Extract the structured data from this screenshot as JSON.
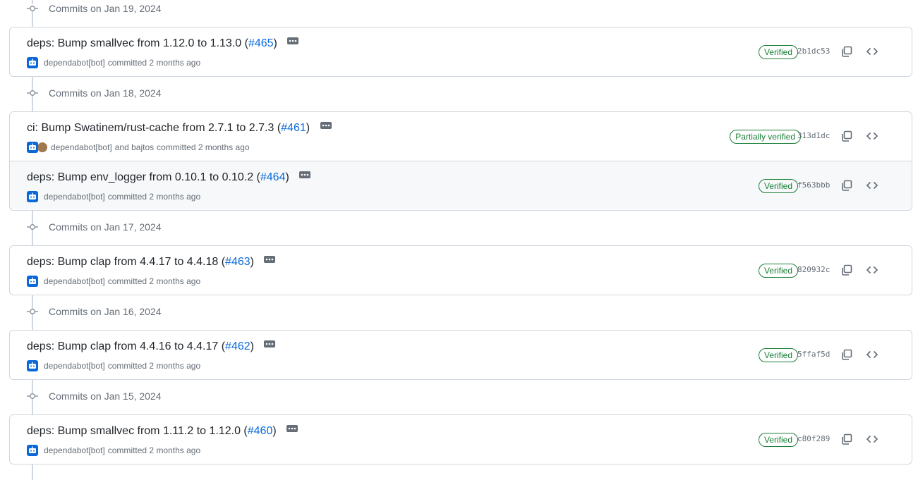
{
  "groups": [
    {
      "title": "Commits on Jan 19, 2024",
      "commits": [
        {
          "prefix": "deps: Bump smallvec from 1.12.0 to 1.13.0 (",
          "pr": "#465",
          "suffix": ")",
          "author": "dependabot[bot]",
          "coauthor": "",
          "meta_tail": "committed 2 months ago",
          "badge": "Verified",
          "sha": "2b1dc53",
          "highlight": false
        }
      ]
    },
    {
      "title": "Commits on Jan 18, 2024",
      "commits": [
        {
          "prefix": "ci: Bump Swatinem/rust-cache from 2.7.1 to 2.7.3 (",
          "pr": "#461",
          "suffix": ")",
          "author": "dependabot[bot]",
          "coauthor": "and bajtos",
          "meta_tail": "committed 2 months ago",
          "badge": "Partially verified",
          "sha": "313d1dc",
          "highlight": false
        },
        {
          "prefix": "deps: Bump env_logger from 0.10.1 to 0.10.2 (",
          "pr": "#464",
          "suffix": ")",
          "author": "dependabot[bot]",
          "coauthor": "",
          "meta_tail": "committed 2 months ago",
          "badge": "Verified",
          "sha": "f563bbb",
          "highlight": true
        }
      ]
    },
    {
      "title": "Commits on Jan 17, 2024",
      "commits": [
        {
          "prefix": "deps: Bump clap from 4.4.17 to 4.4.18 (",
          "pr": "#463",
          "suffix": ")",
          "author": "dependabot[bot]",
          "coauthor": "",
          "meta_tail": "committed 2 months ago",
          "badge": "Verified",
          "sha": "820932c",
          "highlight": false
        }
      ]
    },
    {
      "title": "Commits on Jan 16, 2024",
      "commits": [
        {
          "prefix": "deps: Bump clap from 4.4.16 to 4.4.17 (",
          "pr": "#462",
          "suffix": ")",
          "author": "dependabot[bot]",
          "coauthor": "",
          "meta_tail": "committed 2 months ago",
          "badge": "Verified",
          "sha": "5ffaf5d",
          "highlight": false
        }
      ]
    },
    {
      "title": "Commits on Jan 15, 2024",
      "commits": [
        {
          "prefix": "deps: Bump smallvec from 1.11.2 to 1.12.0 (",
          "pr": "#460",
          "suffix": ")",
          "author": "dependabot[bot]",
          "coauthor": "",
          "meta_tail": "committed 2 months ago",
          "badge": "Verified",
          "sha": "c80f289",
          "highlight": false
        }
      ]
    }
  ],
  "icons": {
    "commit_node": "git-commit-icon",
    "more": "kebab-horizontal-icon",
    "bot_avatar": "dependabot-avatar",
    "copy": "copy-icon",
    "browse": "code-icon"
  },
  "colors": {
    "link": "#0969da",
    "verified": "#1a7f37",
    "border": "#d0d7de",
    "muted": "#656d76"
  }
}
